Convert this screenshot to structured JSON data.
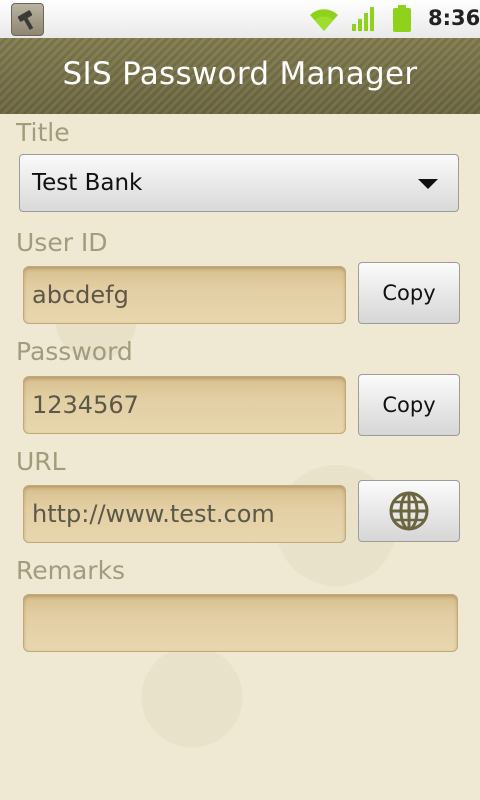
{
  "status_bar": {
    "time": "8:36",
    "icons": [
      "app-notification-icon",
      "wifi-icon",
      "signal-icon",
      "battery-icon"
    ],
    "accent_color": "#8fd21c"
  },
  "app": {
    "title": "SIS Password Manager",
    "titlebar_color": "#756f46"
  },
  "form": {
    "title": {
      "label": "Title",
      "selected": "Test Bank"
    },
    "user_id": {
      "label": "User ID",
      "value": "abcdefg",
      "copy_label": "Copy"
    },
    "password": {
      "label": "Password",
      "value": "1234567",
      "copy_label": "Copy"
    },
    "url": {
      "label": "URL",
      "value": "http://www.test.com",
      "button_icon": "globe-icon"
    },
    "remarks": {
      "label": "Remarks",
      "value": ""
    }
  }
}
